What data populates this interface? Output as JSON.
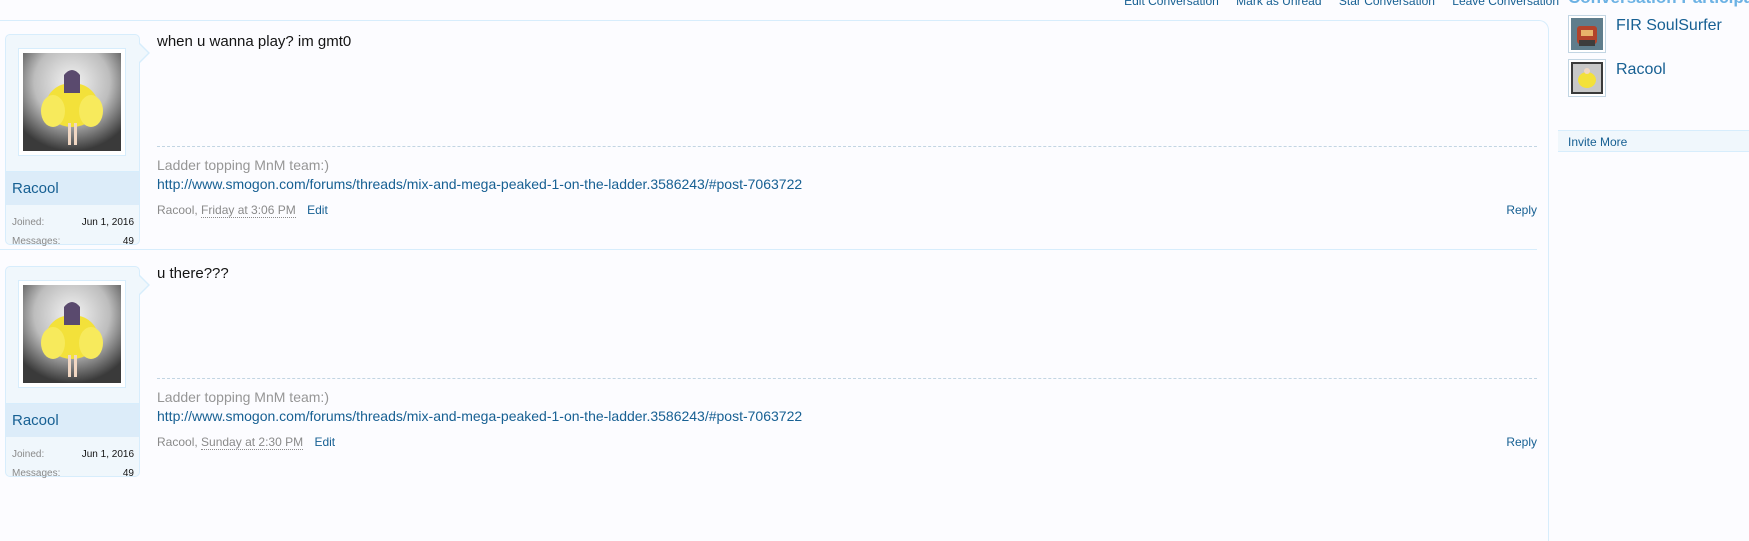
{
  "top_links": [
    "Edit Conversation",
    "Mark as Unread",
    "Star Conversation",
    "Leave Conversation"
  ],
  "messages": [
    {
      "username": "Racool",
      "joined_label": "Joined:",
      "joined_value": "Jun 1, 2016",
      "messages_label": "Messages:",
      "messages_value": "49",
      "text": "when u wanna play? im gmt0",
      "sig_line1": "Ladder topping MnM team:)",
      "sig_link": "http://www.smogon.com/forums/threads/mix-and-mega-peaked-1-on-the-ladder.3586243/#post-7063722",
      "author": "Racool,",
      "date": "Friday at 3:06 PM",
      "edit": "Edit",
      "reply": "Reply"
    },
    {
      "username": "Racool",
      "joined_label": "Joined:",
      "joined_value": "Jun 1, 2016",
      "messages_label": "Messages:",
      "messages_value": "49",
      "text": "u there???",
      "sig_line1": "Ladder topping MnM team:)",
      "sig_link": "http://www.smogon.com/forums/threads/mix-and-mega-peaked-1-on-the-ladder.3586243/#post-7063722",
      "author": "Racool,",
      "date": "Sunday at 2:30 PM",
      "edit": "Edit",
      "reply": "Reply"
    }
  ],
  "sidebar": {
    "heading": "Conversation Participants",
    "participants": [
      {
        "name": "FIR SoulSurfer",
        "avatar_icon": "red-character-avatar"
      },
      {
        "name": "Racool",
        "avatar_icon": "yellow-character-avatar"
      }
    ],
    "invite_label": "Invite More"
  },
  "colors": {
    "link": "#176093",
    "border": "#d7edfc",
    "user_bg": "#f0f7fc",
    "username_bg": "#dcecf9"
  }
}
